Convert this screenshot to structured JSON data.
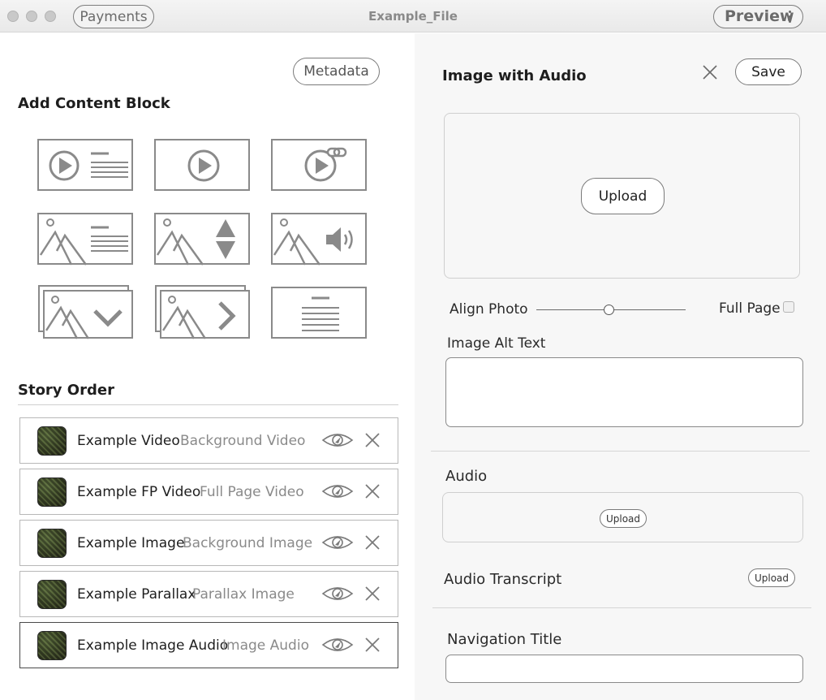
{
  "window": {
    "title": "Example_File",
    "payments_label": "Payments",
    "preview_label": "Preview"
  },
  "left": {
    "metadata_label": "Metadata",
    "add_block_heading": "Add Content Block",
    "content_blocks": [
      "video-text-block",
      "video-block",
      "video-link-block",
      "image-text-block",
      "image-parallax-block",
      "image-audio-block",
      "image-dropdown-block",
      "image-carousel-block",
      "text-block"
    ],
    "story_order_heading": "Story Order",
    "story_items": [
      {
        "title": "Example Video",
        "type": "Background Video"
      },
      {
        "title": "Example FP Video",
        "type": "Full Page Video"
      },
      {
        "title": "Example Image",
        "type": "Background Image"
      },
      {
        "title": "Example Parallax",
        "type": "Parallax Image"
      },
      {
        "title": "Example Image Audio",
        "type": "Image Audio"
      }
    ]
  },
  "right": {
    "title": "Image with Audio",
    "save_label": "Save",
    "upload_label": "Upload",
    "align_photo_label": "Align Photo",
    "align_photo_value": 0.49,
    "full_page_label": "Full Page",
    "full_page_checked": false,
    "alt_text_label": "Image Alt Text",
    "alt_text_value": "",
    "audio_label": "Audio",
    "audio_upload_label": "Upload",
    "transcript_label": "Audio Transcript",
    "transcript_upload_label": "Upload",
    "nav_title_label": "Navigation Title",
    "nav_title_value": ""
  }
}
